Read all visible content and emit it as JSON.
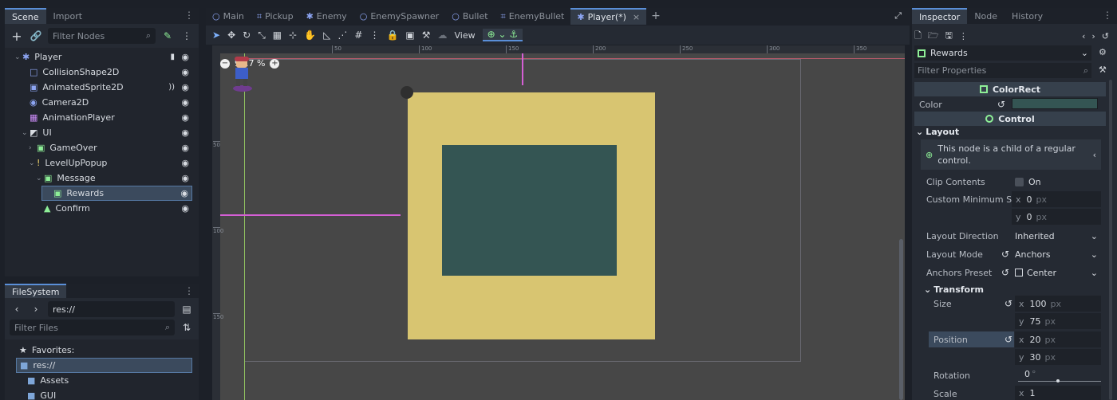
{
  "scene_panel": {
    "tabs": [
      "Scene",
      "Import"
    ],
    "filter_placeholder": "Filter Nodes",
    "nodes": [
      {
        "label": "Player",
        "icon": "node2d-icon",
        "color": "#8da5f3",
        "indent": 0,
        "script": true
      },
      {
        "label": "CollisionShape2D",
        "icon": "collision-shape-icon",
        "color": "#8da5f3",
        "indent": 1
      },
      {
        "label": "AnimatedSprite2D",
        "icon": "animated-sprite-icon",
        "color": "#8da5f3",
        "indent": 1,
        "signal": true
      },
      {
        "label": "Camera2D",
        "icon": "camera-icon",
        "color": "#8da5f3",
        "indent": 1
      },
      {
        "label": "AnimationPlayer",
        "icon": "animation-player-icon",
        "color": "#c98af5",
        "indent": 1
      },
      {
        "label": "UI",
        "icon": "canvas-layer-icon",
        "color": "#d8dce2",
        "indent": 1
      },
      {
        "label": "GameOver",
        "icon": "colorrect-icon",
        "color": "#8eef97",
        "indent": 2
      },
      {
        "label": "LevelUpPopup",
        "icon": "warning-icon",
        "color": "#f3d66c",
        "indent": 2
      },
      {
        "label": "Message",
        "icon": "colorrect-icon",
        "color": "#8eef97",
        "indent": 3
      },
      {
        "label": "Rewards",
        "icon": "colorrect-icon",
        "color": "#8eef97",
        "indent": 4,
        "selected": true
      },
      {
        "label": "Confirm",
        "icon": "button-icon",
        "color": "#8eef97",
        "indent": 3
      }
    ]
  },
  "filesystem": {
    "tab": "FileSystem",
    "path": "res://",
    "filter_placeholder": "Filter Files",
    "items": [
      {
        "label": "Favorites:",
        "icon": "star-icon",
        "indent": 0
      },
      {
        "label": "res://",
        "icon": "folder-icon",
        "indent": 0,
        "selected": true
      },
      {
        "label": "Assets",
        "icon": "folder-icon",
        "indent": 1
      },
      {
        "label": "GUI",
        "icon": "folder-icon",
        "indent": 1
      }
    ]
  },
  "editor_tabs": [
    {
      "label": "Main",
      "icon": "node-icon"
    },
    {
      "label": "Pickup",
      "icon": "area-icon"
    },
    {
      "label": "Enemy",
      "icon": "character-icon"
    },
    {
      "label": "EnemySpawner",
      "icon": "node-icon"
    },
    {
      "label": "Bullet",
      "icon": "node-icon"
    },
    {
      "label": "EnemyBullet",
      "icon": "area-icon"
    },
    {
      "label": "Player(*)",
      "icon": "character-icon",
      "active": true
    }
  ],
  "toolbar": {
    "view_label": "View"
  },
  "viewport": {
    "zoom": "99.7 %",
    "ruler_labels": [
      "50",
      "100",
      "150",
      "200",
      "250",
      "300",
      "350"
    ],
    "ruler_v_labels": [
      "50",
      "100",
      "150"
    ],
    "colors": {
      "bg": "#474747",
      "outer": "#d8c571",
      "inner": "#345553",
      "guide": "#d55fd5"
    }
  },
  "inspector": {
    "tabs": [
      "Inspector",
      "Node",
      "History"
    ],
    "object_name": "Rewards",
    "filter_placeholder": "Filter Properties",
    "colorrect_head": "ColorRect",
    "color_label": "Color",
    "color_value": "#345553",
    "control_head": "Control",
    "layout_head": "Layout",
    "info_text_1": "This node is a child of a regular",
    "info_text_2": "control.",
    "clip_label": "Clip Contents",
    "clip_value": "On",
    "min_size_label": "Custom Minimum S...",
    "min_x": "0",
    "min_y": "0",
    "unit": "px",
    "layout_dir_label": "Layout Direction",
    "layout_dir_value": "Inherited",
    "layout_mode_label": "Layout Mode",
    "layout_mode_value": "Anchors",
    "anchors_label": "Anchors Preset",
    "anchors_value": "Center",
    "transform_head": "Transform",
    "size_label": "Size",
    "size_x": "100",
    "size_y": "75",
    "position_label": "Position",
    "pos_x": "20",
    "pos_y": "30",
    "rotation_label": "Rotation",
    "rotation_value": "0",
    "rotation_unit": "°",
    "scale_label": "Scale",
    "scale_x": "1"
  }
}
